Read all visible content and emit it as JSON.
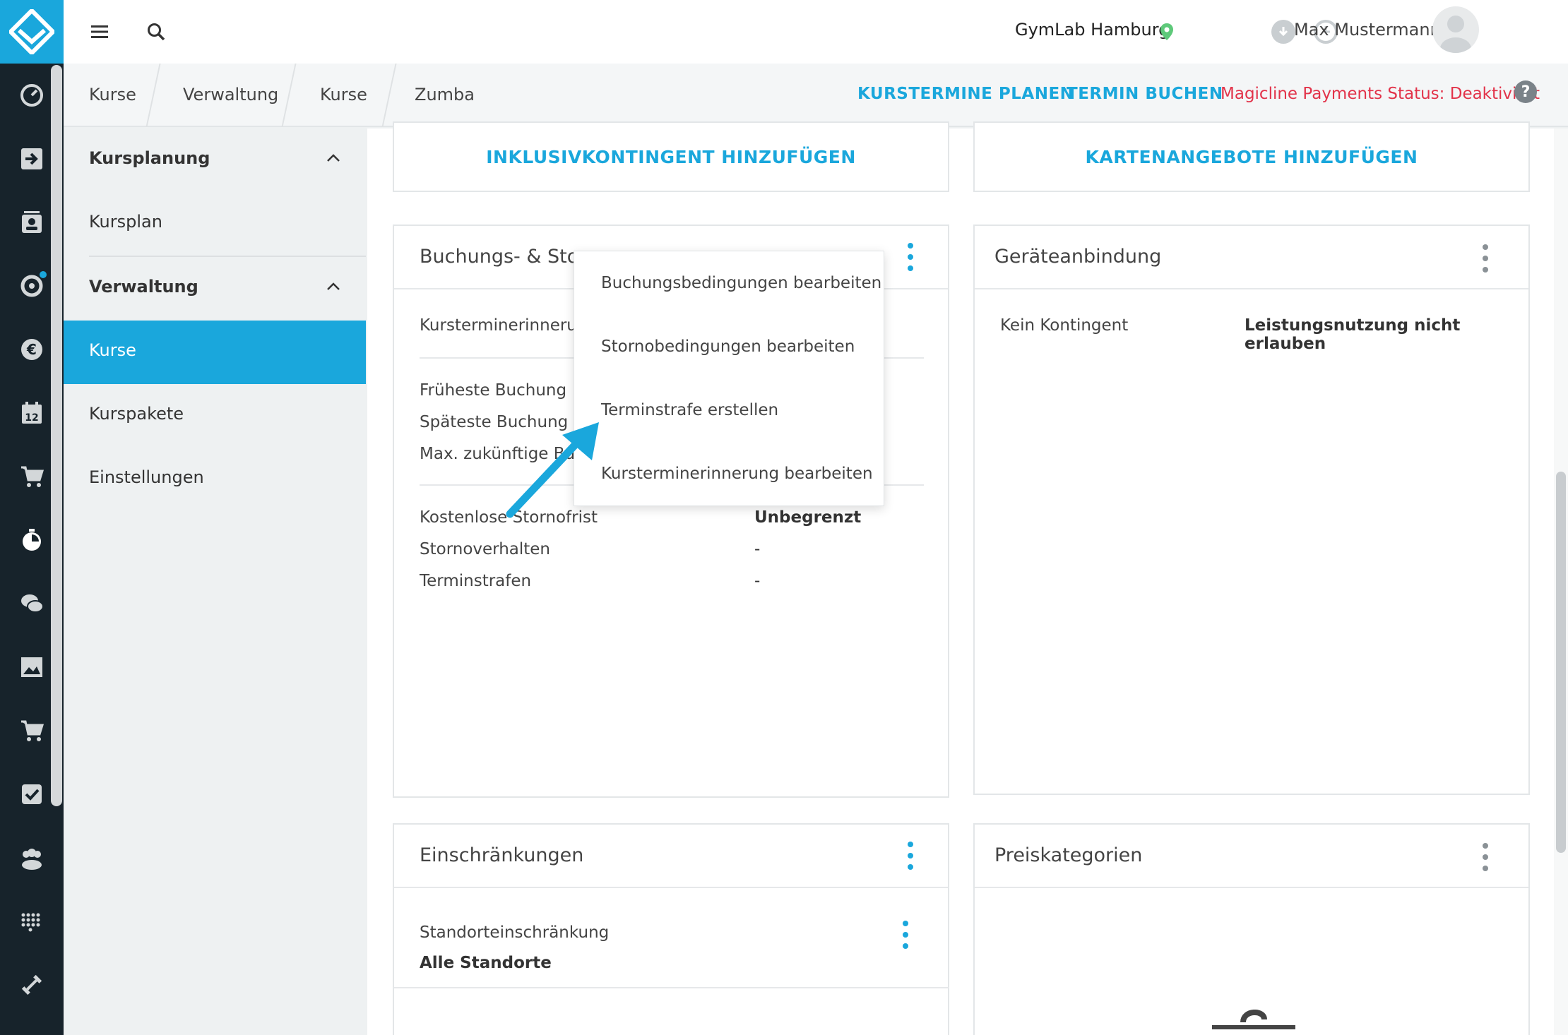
{
  "topbar": {
    "studio": "GymLab Hamburg",
    "user": "Max Mustermann",
    "icons": [
      "menu-icon",
      "search-icon",
      "location-pin-icon",
      "download-icon",
      "clock-icon",
      "avatar"
    ]
  },
  "breadcrumb": [
    "Kurse",
    "Verwaltung",
    "Kurse",
    "Zumba"
  ],
  "actions": {
    "plan": "KURSTERMINE PLANEN",
    "book": "TERMIN BUCHEN",
    "payments": "Magicline Payments Status: Deaktiviert",
    "help": "?"
  },
  "sidebar": {
    "section1": "Kursplanung",
    "item1": "Kursplan",
    "section2": "Verwaltung",
    "items": [
      "Kurse",
      "Kurspakete",
      "Einstellungen"
    ],
    "active": "Kurse"
  },
  "rail_icons": [
    "dashboard-icon",
    "checkin-icon",
    "contacts-icon",
    "settings-icon",
    "euro-icon",
    "calendar-icon",
    "cart-icon",
    "timer-icon",
    "chat-icon",
    "image-icon",
    "shop-icon",
    "checkbox-icon",
    "group-icon",
    "dots-grid-icon",
    "dumbbell-icon"
  ],
  "calendar_day": "12",
  "cards": {
    "add_inclusive": "INKLUSIVKONTINGENT HINZUFÜGEN",
    "add_card_offers": "KARTENANGEBOTE HINZUFÜGEN",
    "booking": {
      "title": "Buchungs- & Stornobedingungen",
      "title_visible": "Buchungs- & Storn",
      "reminder_label": "Kursterminerinnerung",
      "reminder_visible": "Kursterminerinnerun",
      "earliest": "Früheste Buchung",
      "latest": "Späteste Buchung",
      "max_future": "Max. zukünftige Buchungen",
      "max_future_visible": "Max. zukünftige Bu",
      "free_cancel": "Kostenlose Stornofrist",
      "free_cancel_value": "Unbegrenzt",
      "cancel_behaviour": "Stornoverhalten",
      "cancel_behaviour_value": "-",
      "penalties": "Terminstrafen",
      "penalties_value": "-"
    },
    "device": {
      "title": "Geräteanbindung",
      "label": "Kein Kontingent",
      "value": "Leistungsnutzung nicht erlauben"
    },
    "restrictions": {
      "title": "Einschränkungen",
      "location_label": "Standorteinschränkung",
      "location_value": "Alle Standorte"
    },
    "price": {
      "title": "Preiskategorien"
    }
  },
  "menu": [
    "Buchungsbedingungen bearbeiten",
    "Stornobedingungen bearbeiten",
    "Terminstrafe erstellen",
    "Kursterminerinnerung bearbeiten"
  ],
  "colors": {
    "accent": "#1aa7dc",
    "rail": "#17232b",
    "warning": "#e2334a"
  }
}
